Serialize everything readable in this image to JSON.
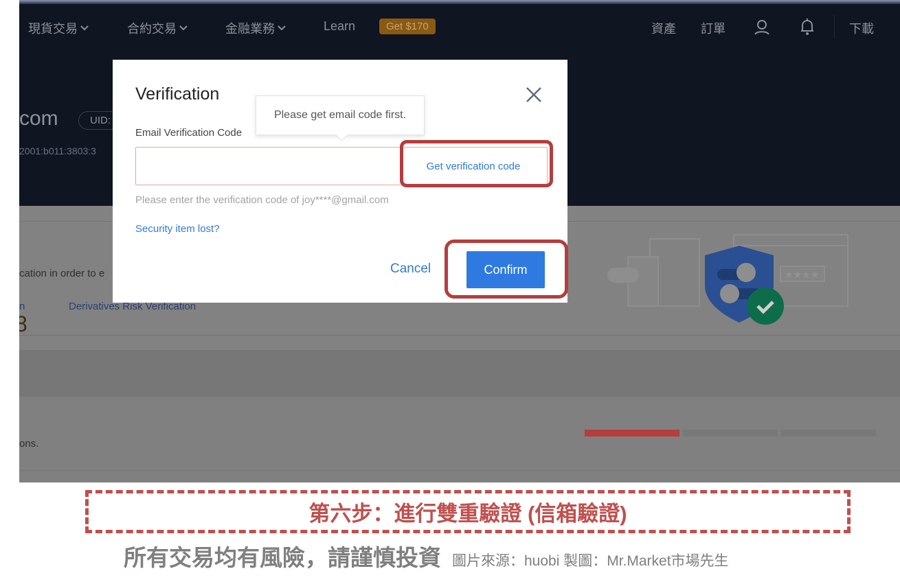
{
  "nav": {
    "items": [
      {
        "label": "現貨交易",
        "has_dropdown": true
      },
      {
        "label": "合約交易",
        "has_dropdown": true
      },
      {
        "label": "金融業務",
        "has_dropdown": true
      },
      {
        "label": "Learn",
        "has_dropdown": false
      }
    ],
    "promo_badge": "Get $170",
    "right_items": [
      "資產",
      "訂單"
    ],
    "download": "下載",
    "icons": [
      "user-icon",
      "bell-icon"
    ]
  },
  "account": {
    "name_fragment": "com",
    "uid_label": "UID:",
    "ip_fragment": "2001:b011:3803:3"
  },
  "background": {
    "desc_fragment": "cation in order to e",
    "tab_fragment": "n",
    "tab_derivatives": "Derivatives Risk Verification",
    "number_fragment": "8",
    "options_fragment": "ons.",
    "security_level": {
      "filled_segments": 1,
      "total_segments": 3,
      "color": "#b53d3d"
    }
  },
  "modal": {
    "title": "Verification",
    "field_label": "Email Verification Code",
    "input_value": "",
    "get_code": "Get verification code",
    "tooltip": "Please get email code first.",
    "hint": "Please enter the verification code of joy****@gmail.com",
    "lost_link": "Security item lost?",
    "cancel": "Cancel",
    "confirm": "Confirm",
    "accent": "#2f7ae0"
  },
  "caption": {
    "step": "第六步：進行雙重驗證 (信箱驗證)",
    "risk": "所有交易均有風險，請謹慎投資",
    "source": "圖片來源：huobi  製圖：Mr.Market市場先生",
    "color": "#c0504d"
  }
}
